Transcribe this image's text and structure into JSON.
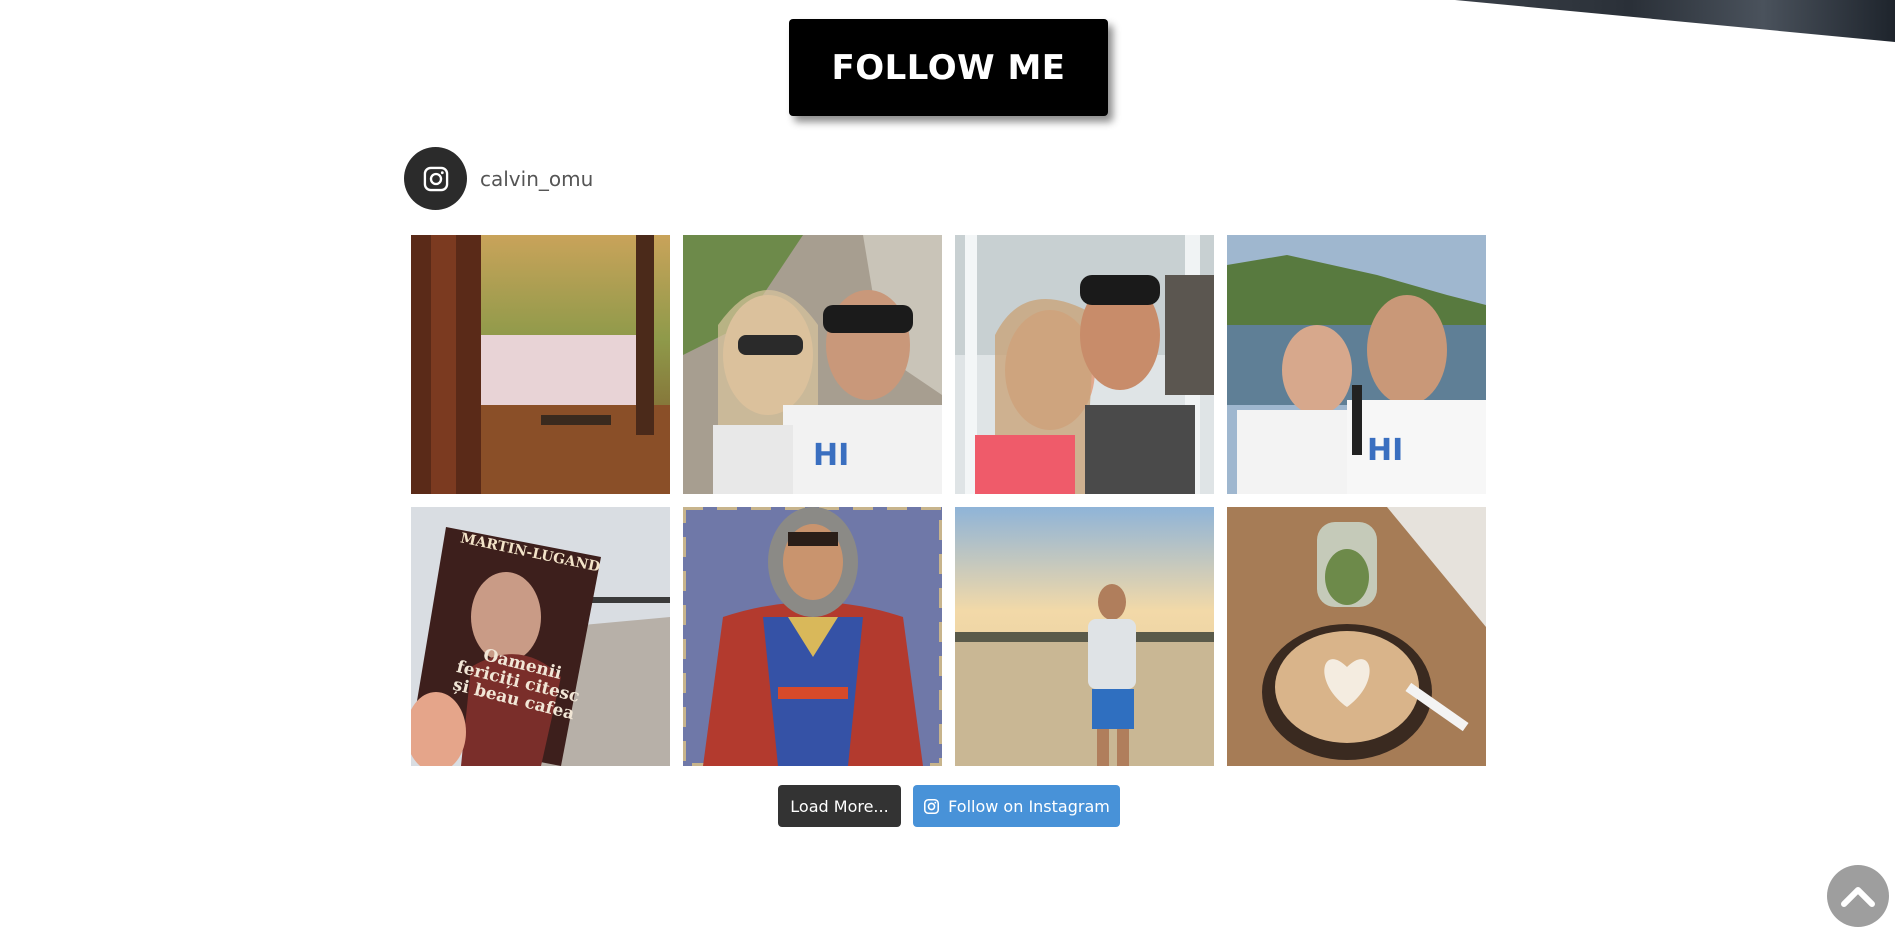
{
  "follow_me": {
    "label": "FOLLOW ME"
  },
  "instagram": {
    "username": "calvin_omu",
    "icon": "instagram-icon"
  },
  "feed": {
    "posts": [
      {
        "subject": "forest lake with bench"
      },
      {
        "subject": "couple selfie at fortress"
      },
      {
        "subject": "couple selfie at waterfall"
      },
      {
        "subject": "couple selfie at river gorge"
      },
      {
        "subject": "book on pier",
        "book_author": "MARTIN-LUGAND",
        "book_title": "Oamenii fericiți citesc și beau cafea"
      },
      {
        "subject": "mosaic knight face cutout"
      },
      {
        "subject": "man at lake sunset"
      },
      {
        "subject": "latte and terrarium jar"
      }
    ]
  },
  "actions": {
    "load_more_label": "Load More...",
    "follow_instagram_label": "Follow on Instagram"
  },
  "scroll_top": {
    "icon": "chevron-up-icon"
  },
  "colors": {
    "follow_me_bg": "#000000",
    "ig_button": "#4892d8",
    "load_more": "#333333",
    "avatar": "#2b2b2b"
  }
}
